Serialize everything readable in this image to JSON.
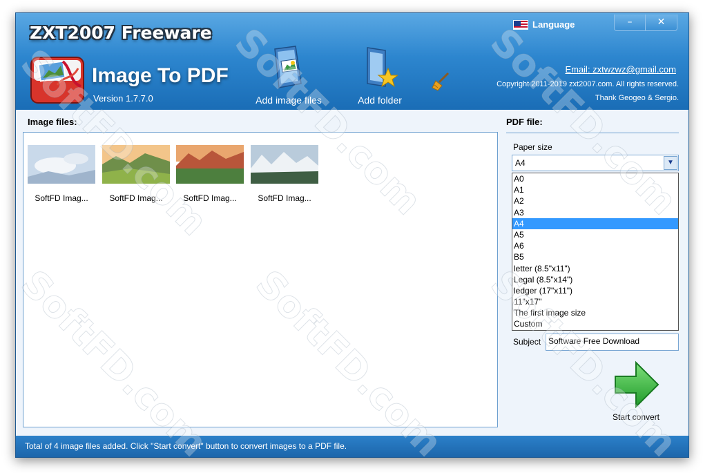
{
  "header": {
    "brand": "ZXT2007 Freeware",
    "app_title": "Image To PDF",
    "version": "Version 1.7.7.0",
    "language_label": "Language",
    "email": "Email: zxtwzwz@gmail.com",
    "copyright": "Copyright  2011-2019 zxt2007.com. All rights reserved.",
    "thanks": "Thank Geogeo & Sergio.",
    "minimize_glyph": "–",
    "close_glyph": "✕"
  },
  "toolbar": {
    "add_images_label": "Add image files",
    "add_folder_label": "Add folder",
    "clear_icon": "broom-icon"
  },
  "images": {
    "title": "Image files:",
    "items": [
      {
        "label": "SoftFD Imag..."
      },
      {
        "label": "SoftFD Imag..."
      },
      {
        "label": "SoftFD Imag..."
      },
      {
        "label": "SoftFD Imag..."
      }
    ]
  },
  "pdf": {
    "title": "PDF file:",
    "paper_label": "Paper size",
    "paper_selected": "A4",
    "paper_options": [
      "A0",
      "A1",
      "A2",
      "A3",
      "A4",
      "A5",
      "A6",
      "B5",
      "letter (8.5\"x11\")",
      "Legal (8.5\"x14\")",
      "ledger (17\"x11\")",
      "11\"x17\"",
      "The first image size",
      "Custom"
    ],
    "subject_label": "Subject",
    "subject_value": "Software Free Download",
    "convert_label": "Start convert"
  },
  "status": {
    "text": "Total of 4 image files added. Click \"Start convert\" button to convert images to a PDF file."
  },
  "watermark": "SoftFD.com",
  "colors": {
    "header_blue": "#2d86cf",
    "selection_blue": "#3399ff",
    "convert_green": "#3db53d"
  }
}
